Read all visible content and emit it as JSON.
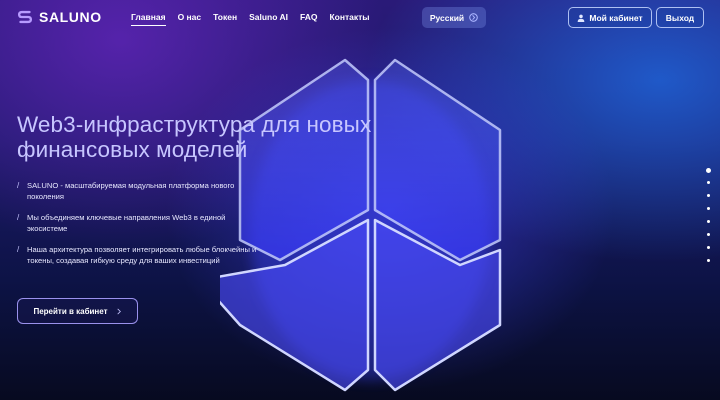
{
  "header": {
    "logo_text": "SALUNO",
    "nav": [
      {
        "label": "Главная",
        "active": true
      },
      {
        "label": "О нас",
        "active": false
      },
      {
        "label": "Токен",
        "active": false
      },
      {
        "label": "Saluno AI",
        "active": false
      },
      {
        "label": "FAQ",
        "active": false
      },
      {
        "label": "Контакты",
        "active": false
      }
    ],
    "language": "Русский",
    "cabinet_button": "Мой кабинет",
    "logout_button": "Выход"
  },
  "hero": {
    "title": "Web3-инфраструктура для новых финансовых моделей",
    "features": [
      "SALUNO - масштабируемая модульная платформа нового поколения",
      "Мы объединяем ключевые направления Web3 в единой экосистеме",
      "Наша архитектура позволяет интегрировать любые блокчейны и токены, создавая гибкую среду для ваших инвестиций"
    ],
    "cta_button": "Перейти в кабинет"
  },
  "pagination": {
    "total": 8,
    "active_index": 0
  },
  "colors": {
    "title": "#c7c6ff",
    "accent_glow": "#4a5cff",
    "background_dark": "#070a20"
  },
  "icons": [
    "logo-s-icon",
    "language-icon",
    "user-icon",
    "chevron-right-icon"
  ]
}
